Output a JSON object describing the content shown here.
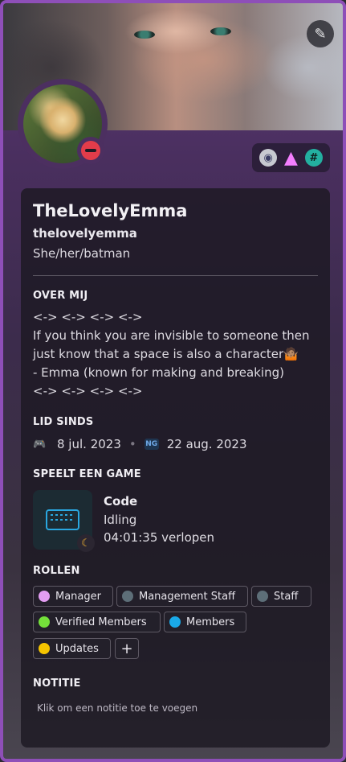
{
  "profile": {
    "display_name": "TheLovelyEmma",
    "username": "thelovelyemma",
    "pronouns": "She/her/batman",
    "status": "do-not-disturb",
    "edit_icon": "pencil-icon"
  },
  "badges": [
    {
      "name": "nitro-badge-icon"
    },
    {
      "name": "hypesquad-badge-icon"
    },
    {
      "name": "hash-badge-icon"
    }
  ],
  "about": {
    "title": "OVER MIJ",
    "lines": [
      "<-> <-> <-> <->",
      "If you think you are invisible to someone then",
      "just know that a space is also a character🤷🏽",
      "- Emma (known for making and breaking)",
      "<-> <-> <-> <->"
    ]
  },
  "member_since": {
    "title": "LID SINDS",
    "discord_date": "8 jul. 2023",
    "server_date": "22 aug. 2023",
    "server_icon_text": "NG"
  },
  "game": {
    "title": "SPEELT EEN GAME",
    "name": "Code",
    "state": "Idling",
    "elapsed": "04:01:35 verlopen"
  },
  "roles": {
    "title": "ROLLEN",
    "items": [
      {
        "label": "Manager",
        "color": "#e39df2"
      },
      {
        "label": "Management Staff",
        "color": "#5d6e78"
      },
      {
        "label": "Staff",
        "color": "#5d6e78"
      },
      {
        "label": "Verified Members",
        "color": "#74e03a"
      },
      {
        "label": "Members",
        "color": "#1aa9e8"
      },
      {
        "label": "Updates",
        "color": "#f5c400"
      }
    ],
    "add_label": "+"
  },
  "note": {
    "title": "NOTITIE",
    "placeholder": "Klik om een notitie toe te voegen"
  }
}
